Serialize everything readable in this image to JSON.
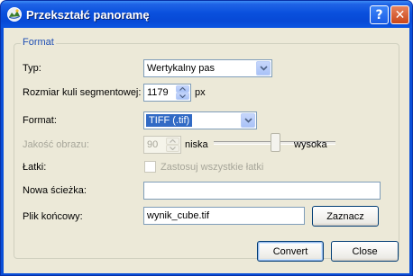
{
  "window": {
    "title": "Przekształć panoramę",
    "help_label": "?",
    "close_label": "✕"
  },
  "group": {
    "title": "Format"
  },
  "fields": {
    "type": {
      "label": "Typ:",
      "value": "Wertykalny pas"
    },
    "cube_size": {
      "label": "Rozmiar kuli segmentowej:",
      "value": "1179",
      "unit": "px"
    },
    "format": {
      "label": "Format:",
      "value": "TIFF (.tif)"
    },
    "quality": {
      "label": "Jakość obrazu:",
      "value": "90",
      "low_label": "niska",
      "high_label": "wysoka",
      "level_percent": 48
    },
    "patches": {
      "label": "Łatki:",
      "checkbox_label": "Zastosuj wszystkie łatki",
      "checked": false
    },
    "new_path": {
      "label": "Nowa ścieżka:",
      "value": ""
    },
    "output_file": {
      "label": "Plik końcowy:",
      "value": "wynik_cube.tif",
      "button_label": "Zaznacz"
    }
  },
  "actions": {
    "convert_label": "Convert",
    "close_label": "Close"
  },
  "icons": {
    "app": "panorama-app-icon",
    "dropdown": "chevron-down-icon",
    "spin_up": "arrow-up-icon",
    "spin_down": "arrow-down-icon"
  }
}
